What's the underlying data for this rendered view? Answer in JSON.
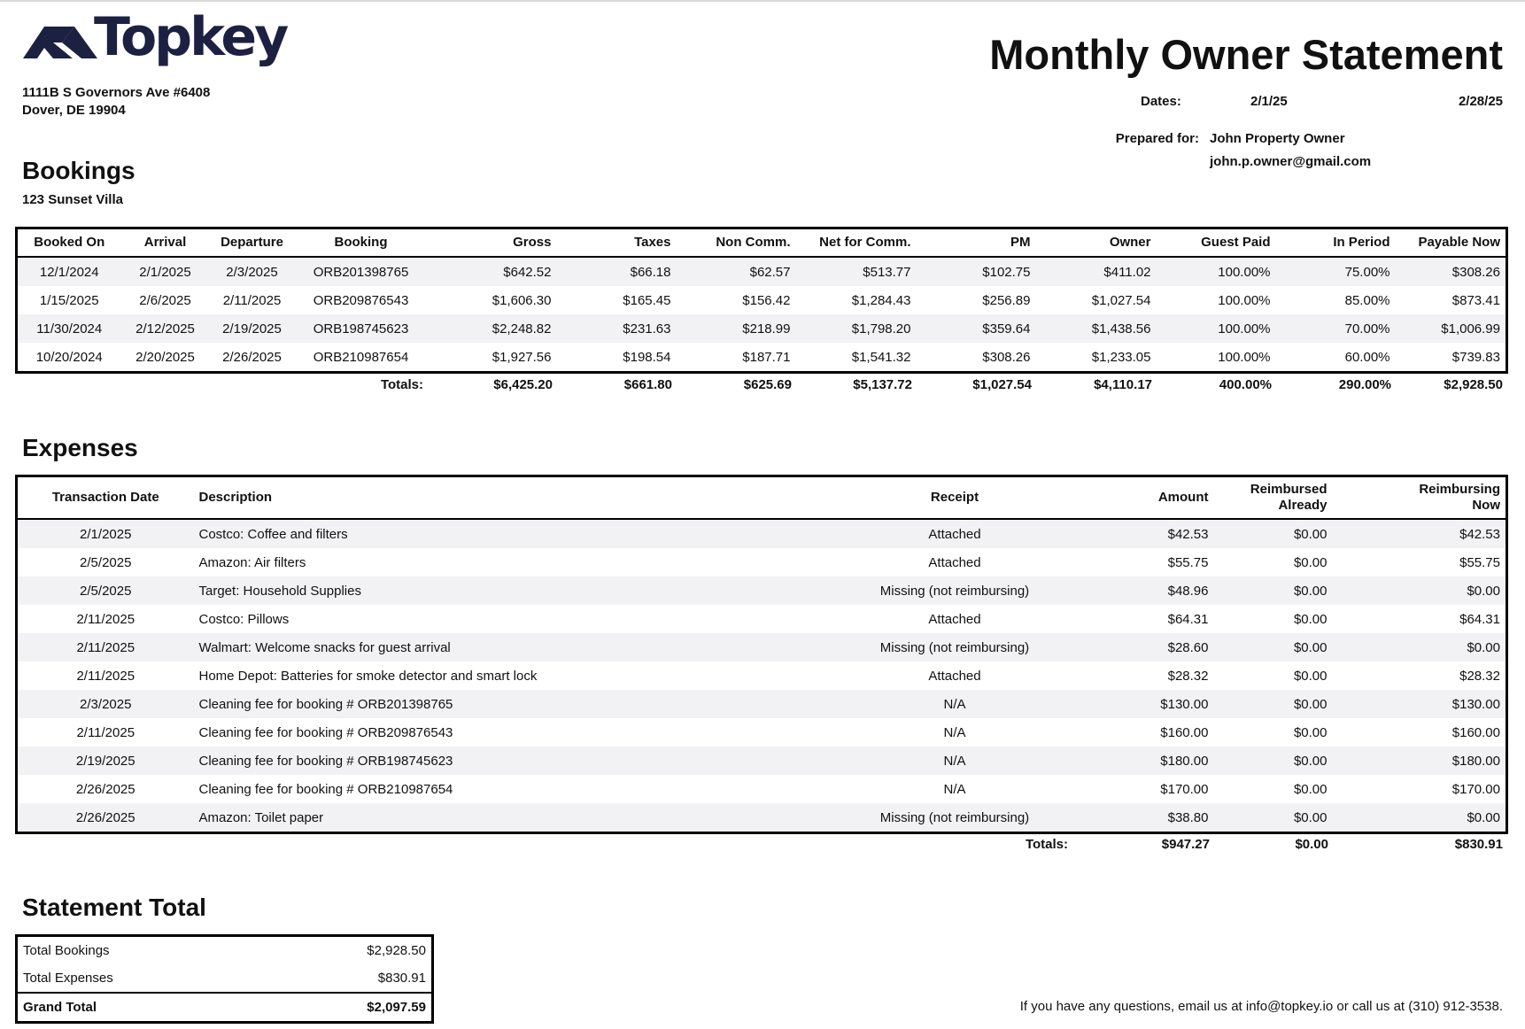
{
  "company": {
    "name": "Topkey",
    "address_line1": "1111B S Governors Ave #6408",
    "address_line2": "Dover, DE 19904"
  },
  "title": "Monthly Owner Statement",
  "dates": {
    "label": "Dates:",
    "start": "2/1/25",
    "end": "2/28/25"
  },
  "prepared": {
    "label": "Prepared for:",
    "name": "John Property Owner",
    "email": "john.p.owner@gmail.com"
  },
  "bookings": {
    "heading": "Bookings",
    "property": "123 Sunset Villa",
    "columns": [
      "Booked On",
      "Arrival",
      "Departure",
      "Booking",
      "Gross",
      "Taxes",
      "Non Comm.",
      "Net for Comm.",
      "PM",
      "Owner",
      "Guest Paid",
      "In Period",
      "Payable Now"
    ],
    "rows": [
      [
        "12/1/2024",
        "2/1/2025",
        "2/3/2025",
        "ORB201398765",
        "$642.52",
        "$66.18",
        "$62.57",
        "$513.77",
        "$102.75",
        "$411.02",
        "100.00%",
        "75.00%",
        "$308.26"
      ],
      [
        "1/15/2025",
        "2/6/2025",
        "2/11/2025",
        "ORB209876543",
        "$1,606.30",
        "$165.45",
        "$156.42",
        "$1,284.43",
        "$256.89",
        "$1,027.54",
        "100.00%",
        "85.00%",
        "$873.41"
      ],
      [
        "11/30/2024",
        "2/12/2025",
        "2/19/2025",
        "ORB198745623",
        "$2,248.82",
        "$231.63",
        "$218.99",
        "$1,798.20",
        "$359.64",
        "$1,438.56",
        "100.00%",
        "70.00%",
        "$1,006.99"
      ],
      [
        "10/20/2024",
        "2/20/2025",
        "2/26/2025",
        "ORB210987654",
        "$1,927.56",
        "$198.54",
        "$187.71",
        "$1,541.32",
        "$308.26",
        "$1,233.05",
        "100.00%",
        "60.00%",
        "$739.83"
      ]
    ],
    "totals_label": "Totals:",
    "totals": [
      "$6,425.20",
      "$661.80",
      "$625.69",
      "$5,137.72",
      "$1,027.54",
      "$4,110.17",
      "400.00%",
      "290.00%",
      "$2,928.50"
    ]
  },
  "expenses": {
    "heading": "Expenses",
    "columns": {
      "date": "Transaction Date",
      "description": "Description",
      "receipt": "Receipt",
      "amount": "Amount",
      "reimbursed_1": "Reimbursed",
      "reimbursed_2": "Already",
      "reimbursing_1": "Reimbursing",
      "reimbursing_2": "Now"
    },
    "rows": [
      [
        "2/1/2025",
        "Costco: Coffee and filters",
        "Attached",
        "$42.53",
        "$0.00",
        "$42.53"
      ],
      [
        "2/5/2025",
        "Amazon: Air filters",
        "Attached",
        "$55.75",
        "$0.00",
        "$55.75"
      ],
      [
        "2/5/2025",
        "Target: Household Supplies",
        "Missing (not reimbursing)",
        "$48.96",
        "$0.00",
        "$0.00"
      ],
      [
        "2/11/2025",
        "Costco: Pillows",
        "Attached",
        "$64.31",
        "$0.00",
        "$64.31"
      ],
      [
        "2/11/2025",
        "Walmart: Welcome snacks for guest arrival",
        "Missing (not reimbursing)",
        "$28.60",
        "$0.00",
        "$0.00"
      ],
      [
        "2/11/2025",
        "Home Depot: Batteries for smoke detector and smart lock",
        "Attached",
        "$28.32",
        "$0.00",
        "$28.32"
      ],
      [
        "2/3/2025",
        "Cleaning fee for booking # ORB201398765",
        "N/A",
        "$130.00",
        "$0.00",
        "$130.00"
      ],
      [
        "2/11/2025",
        "Cleaning fee for booking # ORB209876543",
        "N/A",
        "$160.00",
        "$0.00",
        "$160.00"
      ],
      [
        "2/19/2025",
        "Cleaning fee for booking # ORB198745623",
        "N/A",
        "$180.00",
        "$0.00",
        "$180.00"
      ],
      [
        "2/26/2025",
        "Cleaning fee for booking # ORB210987654",
        "N/A",
        "$170.00",
        "$0.00",
        "$170.00"
      ],
      [
        "2/26/2025",
        "Amazon: Toilet paper",
        "Missing (not reimbursing)",
        "$38.80",
        "$0.00",
        "$0.00"
      ]
    ],
    "totals_label": "Totals:",
    "totals": [
      "$947.27",
      "$0.00",
      "$830.91"
    ]
  },
  "statement": {
    "heading": "Statement Total",
    "rows": [
      {
        "label": "Total Bookings",
        "value": "$2,928.50"
      },
      {
        "label": "Total Expenses",
        "value": "$830.91"
      },
      {
        "label": "Grand Total",
        "value": "$2,097.59"
      }
    ]
  },
  "footer": "If you have any questions, email us at info@topkey.io or call us at (310) 912-3538.",
  "colors": {
    "brand": "#1c2142",
    "row_alt": "#f2f2f4",
    "border": "#000000"
  },
  "icons": {
    "logo": "topkey-logo-mark"
  }
}
